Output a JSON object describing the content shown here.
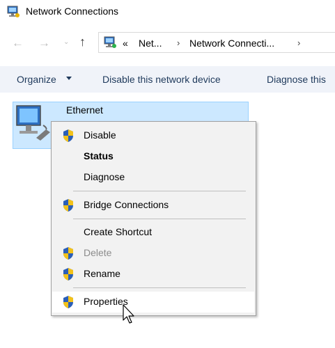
{
  "window": {
    "title": "Network Connections"
  },
  "address_bar": {
    "overflow": "«",
    "crumbs": [
      "Net...",
      "Network Connecti..."
    ],
    "separator": "›",
    "trailing_separator": "›"
  },
  "nav": {
    "back": "←",
    "forward": "→",
    "recent": "⌄",
    "up": "↑"
  },
  "command_bar": {
    "organize": "Organize",
    "disable_device": "Disable this network device",
    "diagnose": "Diagnose this"
  },
  "item": {
    "label": "Ethernet",
    "selected": true
  },
  "context_menu": {
    "items": [
      {
        "label": "Disable",
        "shield": true,
        "bold": false,
        "disabled": false
      },
      {
        "label": "Status",
        "shield": false,
        "bold": true,
        "disabled": false
      },
      {
        "label": "Diagnose",
        "shield": false,
        "bold": false,
        "disabled": false
      },
      {
        "label": "Bridge Connections",
        "shield": true,
        "bold": false,
        "disabled": false
      },
      {
        "label": "Create Shortcut",
        "shield": false,
        "bold": false,
        "disabled": false
      },
      {
        "label": "Delete",
        "shield": true,
        "bold": false,
        "disabled": true
      },
      {
        "label": "Rename",
        "shield": true,
        "bold": false,
        "disabled": false
      },
      {
        "label": "Properties",
        "shield": true,
        "bold": false,
        "disabled": false,
        "hovered": true
      }
    ]
  },
  "colors": {
    "selection_bg": "#cce8ff",
    "selection_border": "#99d1ff",
    "command_bar_bg": "#f0f3f9",
    "command_text": "#1e395b",
    "menu_bg": "#f2f2f2"
  }
}
